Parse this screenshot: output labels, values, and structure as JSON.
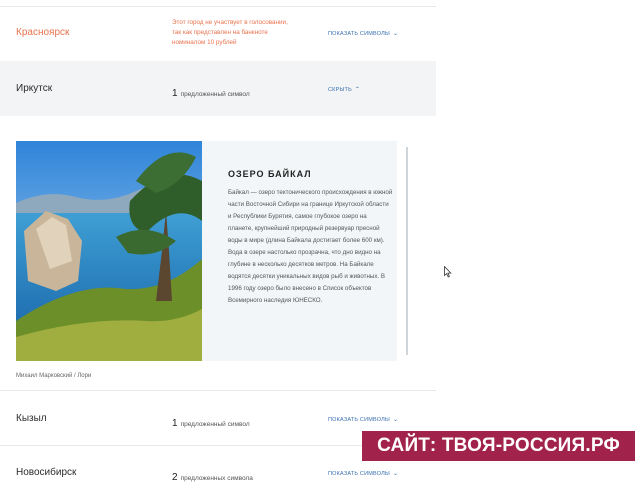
{
  "rows": {
    "krasnoyarsk": {
      "city": "Красноярск",
      "note": "Этот город не участвует в голосовании, так как представлен на банкноте номиналом 10 рублей",
      "toggle": "ПОКАЗАТЬ СИМВОЛЫ"
    },
    "irkutsk": {
      "city": "Иркутск",
      "count": "1",
      "count_label": "предложенный символ",
      "toggle": "СКРЫТЬ"
    },
    "kyzyl": {
      "city": "Кызыл",
      "count": "1",
      "count_label": "предложенный символ",
      "toggle": "ПОКАЗАТЬ СИМВОЛЫ"
    },
    "novosibirsk": {
      "city": "Новосибирск",
      "count": "2",
      "count_label": "предложенных символа",
      "toggle": "ПОКАЗАТЬ СИМВОЛЫ"
    }
  },
  "symbol_card": {
    "title": "ОЗЕРО БАЙКАЛ",
    "description": "Байкал — озеро тектонического происхождения в южной части Восточной Сибири на границе Иркутской области и Республики Бурятия, самое глубокое озеро на планете, крупнейший природный резервуар пресной воды в мире (длина Байкала достигает более 600 км). Вода в озере настолько прозрачна, что дно видно на глубине в несколько десятков метров. На Байкале водятся десятки уникальных видов рыб и животных. В 1996 году озеро было внесено в Список объектов Всемирного наследия ЮНЕСКО.",
    "photo_credit": "Михаил Марковский / Лори"
  },
  "banner": {
    "text": "САЙТ: ТВОЯ-РОССИЯ.РФ"
  },
  "icons": {
    "chevron_down": "chevron-down-icon",
    "chevron_up": "chevron-up-icon",
    "cursor": "mouse-cursor-icon"
  },
  "colors": {
    "accent_link": "#3a6fb0",
    "note_orange": "#e8734e",
    "highlight_row": "#f2f4f6",
    "banner_bg": "#a1234c"
  }
}
